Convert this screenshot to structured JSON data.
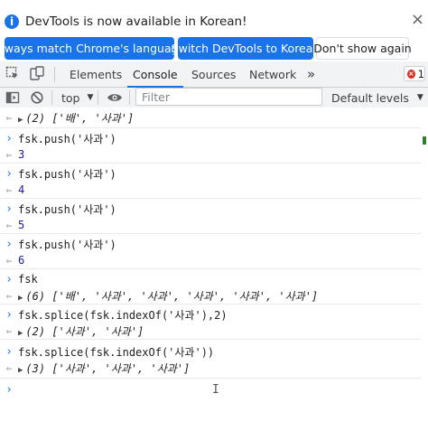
{
  "infobar": {
    "message": "DevTools is now available in Korean!",
    "buttons": {
      "match": "Always match Chrome's language",
      "switch": "Switch DevTools to Korean",
      "dont_show": "Don't show again"
    }
  },
  "tabs": {
    "elements": "Elements",
    "console": "Console",
    "sources": "Sources",
    "network": "Network",
    "more": "»",
    "error_count": "1"
  },
  "toolbar": {
    "context": "top",
    "filter_placeholder": "Filter",
    "levels": "Default levels"
  },
  "console": {
    "entries": [
      {
        "type": "result",
        "text": "(2) ['배', '사과']"
      },
      {
        "type": "input",
        "text": "fsk.push('사과')"
      },
      {
        "type": "result",
        "text": "3"
      },
      {
        "type": "input",
        "text": "fsk.push('사과')"
      },
      {
        "type": "result",
        "text": "4"
      },
      {
        "type": "input",
        "text": "fsk.push('사과')"
      },
      {
        "type": "result",
        "text": "5"
      },
      {
        "type": "input",
        "text": "fsk.push('사과')"
      },
      {
        "type": "result",
        "text": "6"
      },
      {
        "type": "input",
        "text": "fsk"
      },
      {
        "type": "result",
        "text": "(6) ['배', '사과', '사과', '사과', '사과', '사과']"
      },
      {
        "type": "input",
        "text": "fsk.splice(fsk.indexOf('사과'),2)"
      },
      {
        "type": "result",
        "text": "(2) ['사과', '사과']"
      },
      {
        "type": "input",
        "text": "fsk.splice(fsk.indexOf('사과'))"
      },
      {
        "type": "result",
        "text": "(3) ['사과', '사과', '사과']"
      }
    ]
  },
  "colors": {
    "accent": "#1a73e8",
    "error": "#d93025",
    "string": "#c41a16",
    "number": "#1a1aa6"
  }
}
